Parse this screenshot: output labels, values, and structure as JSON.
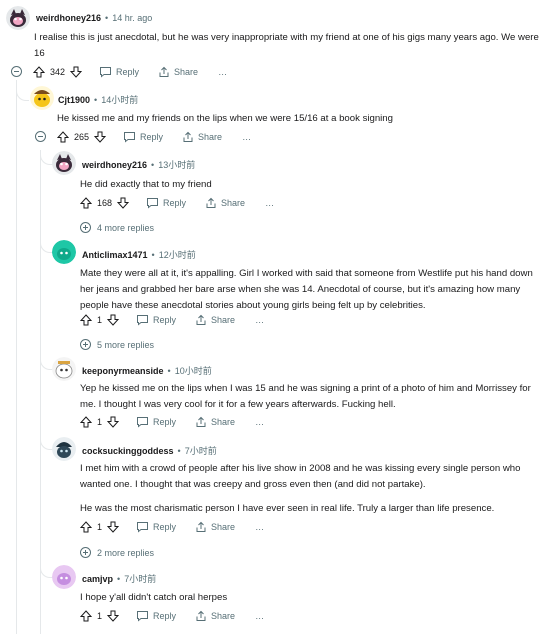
{
  "actions": {
    "reply": "Reply",
    "share": "Share",
    "more": "…"
  },
  "comments": [
    {
      "user": "weirdhoney216",
      "time": "14 hr. ago",
      "score": "342",
      "body": [
        "I realise this is just anecdotal, but he was very inappropriate with my friend at one of his gigs many years ago. We were 16"
      ],
      "avatar": "snoo-pink-icon"
    },
    {
      "user": "Cjt1900",
      "time": "14小时前",
      "score": "265",
      "body": [
        "He kissed me and my friends on the lips when we were 15/16 at a book signing"
      ],
      "avatar": "snoo-yellow-icon"
    },
    {
      "user": "weirdhoney216",
      "time": "13小时前",
      "score": "168",
      "body": [
        "He did exactly that to my friend"
      ],
      "avatar": "snoo-pink-icon",
      "more_replies": "4 more replies"
    },
    {
      "user": "Anticlimax1471",
      "time": "12小时前",
      "score": "1",
      "body": [
        "Mate they were all at it, it's appalling. Girl I worked with said that someone from Westlife put his hand down her jeans and grabbed her bare arse when she was 14. Anecdotal of course, but it's amazing how many people have these anecdotal stories about young girls being felt up by celebrities."
      ],
      "avatar": "snoo-teal-icon",
      "more_replies": "5 more replies"
    },
    {
      "user": "keeponyrmeanside",
      "time": "10小时前",
      "score": "1",
      "body": [
        "Yep he kissed me on the lips when I was 15 and he was signing a print of a photo of him and Morrissey for me. I thought I was very cool for it for a few years afterwards. Fucking hell."
      ],
      "avatar": "snoo-white-icon"
    },
    {
      "user": "cocksuckinggoddess",
      "time": "7小时前",
      "score": "1",
      "body": [
        "I met him with a crowd of people after his live show in 2008 and he was kissing every single person who wanted one. I thought that was creepy and gross even then (and did not partake).",
        "He was the most charismatic person I have ever seen in real life. Truly a larger than life presence."
      ],
      "avatar": "snoo-dark-icon",
      "more_replies": "2 more replies"
    },
    {
      "user": "camjvp",
      "time": "7小时前",
      "score": "1",
      "body": [
        "I hope y'all didn't catch oral herpes"
      ],
      "avatar": "snoo-purple-icon"
    }
  ]
}
